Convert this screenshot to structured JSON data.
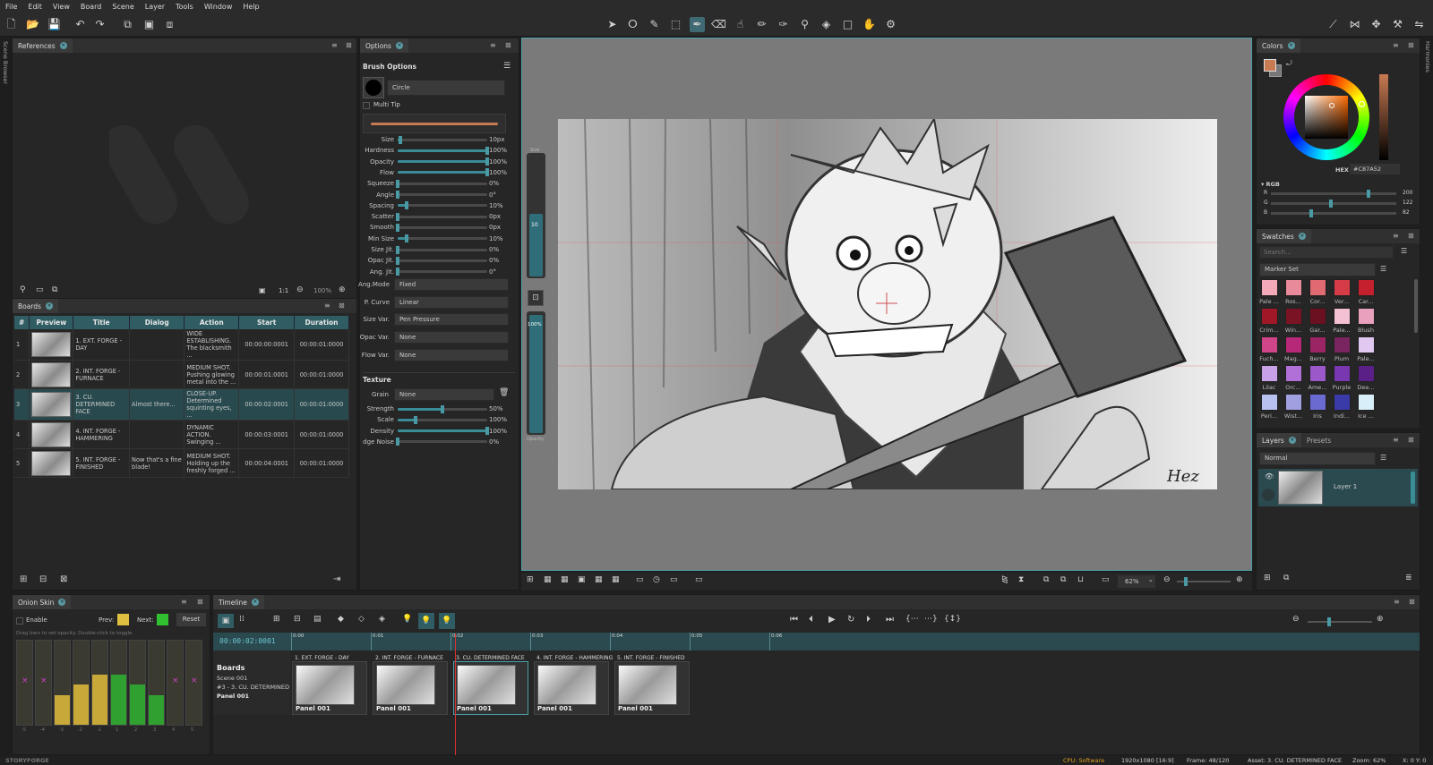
{
  "menu": [
    "File",
    "Edit",
    "View",
    "Board",
    "Scene",
    "Layer",
    "Tools",
    "Window",
    "Help"
  ],
  "references": {
    "tab": "References",
    "zoom_label": "1:1",
    "zoom_pct": "100%"
  },
  "side_left": "Scene Browser",
  "side_right": "Harmonies",
  "boards": {
    "tab": "Boards",
    "columns": [
      "#",
      "Preview",
      "Title",
      "Dialog",
      "Action",
      "Start",
      "Duration"
    ],
    "rows": [
      {
        "num": "1",
        "title": "1. EXT. FORGE - DAY",
        "dialog": "",
        "action": "WIDE ESTABLISHING. The blacksmith ...",
        "start": "00:00:00:0001",
        "duration": "00:00:01:0000"
      },
      {
        "num": "2",
        "title": "2. INT. FORGE - FURNACE",
        "dialog": "",
        "action": "MEDIUM SHOT. Pushing glowing metal into the ...",
        "start": "00:00:01:0001",
        "duration": "00:00:01:0000"
      },
      {
        "num": "3",
        "title": "3. CU. DETERMINED FACE",
        "dialog": "Almost there...",
        "action": "CLOSE-UP. Determined squinting eyes, ...",
        "start": "00:00:02:0001",
        "duration": "00:00:01:0000"
      },
      {
        "num": "4",
        "title": "4. INT. FORGE - HAMMERING",
        "dialog": "",
        "action": "DYNAMIC ACTION. Swinging ...",
        "start": "00:00:03:0001",
        "duration": "00:00:01:0000"
      },
      {
        "num": "5",
        "title": "5. INT. FORGE - FINISHED",
        "dialog": "Now that's a fine blade!",
        "action": "MEDIUM SHOT. Holding up the freshly forged ...",
        "start": "00:00:04:0001",
        "duration": "00:00:01:0000"
      }
    ]
  },
  "options": {
    "tab": "Options",
    "heading": "Brush Options",
    "brush_name": "Circle",
    "multi_tip": "Multi Tip",
    "sliders": [
      {
        "label": "Size",
        "value": "10px",
        "frac": 0.03
      },
      {
        "label": "Hardness",
        "value": "100%",
        "frac": 1.0
      },
      {
        "label": "Opacity",
        "value": "100%",
        "frac": 1.0
      },
      {
        "label": "Flow",
        "value": "100%",
        "frac": 1.0
      },
      {
        "label": "Squeeze",
        "value": "0%",
        "frac": 0.0
      },
      {
        "label": "Angle",
        "value": "0°",
        "frac": 0.0
      },
      {
        "label": "Spacing",
        "value": "10%",
        "frac": 0.1
      },
      {
        "label": "Scatter",
        "value": "0px",
        "frac": 0.0
      },
      {
        "label": "Smooth",
        "value": "0px",
        "frac": 0.0
      },
      {
        "label": "Min Size",
        "value": "10%",
        "frac": 0.1
      },
      {
        "label": "Size Jit.",
        "value": "0%",
        "frac": 0.0
      },
      {
        "label": "Opac Jit.",
        "value": "0%",
        "frac": 0.0
      },
      {
        "label": "Ang. Jit.",
        "value": "0°",
        "frac": 0.0
      }
    ],
    "dropdowns": [
      {
        "label": "Ang.Mode",
        "value": "Fixed"
      },
      {
        "label": "P. Curve",
        "value": "Linear"
      },
      {
        "label": "Size Var.",
        "value": "Pen Pressure"
      },
      {
        "label": "Opac Var.",
        "value": "None"
      },
      {
        "label": "Flow Var.",
        "value": "None"
      }
    ],
    "texture_heading": "Texture",
    "grain_label": "Grain",
    "grain_value": "None",
    "texture_sliders": [
      {
        "label": "Strength",
        "value": "50%",
        "frac": 0.5
      },
      {
        "label": "Scale",
        "value": "100%",
        "frac": 0.2
      },
      {
        "label": "Density",
        "value": "100%",
        "frac": 1.0
      },
      {
        "label": "dge Noise",
        "value": "0%",
        "frac": 0.0
      }
    ]
  },
  "canvas_side": {
    "size_label": "Size",
    "size_value": "10",
    "opacity_value": "100%",
    "opacity_label": "Opacity"
  },
  "canvas_bottom": {
    "zoom": "62%"
  },
  "colors": {
    "tab": "Colors",
    "hex_label": "HEX",
    "hex_value": "#C87A52",
    "rgb_header": "RGB",
    "rgb": [
      {
        "label": "R",
        "value": "200",
        "frac": 0.78
      },
      {
        "label": "G",
        "value": "122",
        "frac": 0.48
      },
      {
        "label": "B",
        "value": "82",
        "frac": 0.32
      }
    ],
    "accent": "#C87A52"
  },
  "swatches": {
    "tab": "Swatches",
    "search_placeholder": "Search...",
    "set": "Marker Set",
    "items": [
      {
        "name": "Pale ...",
        "color": "#f4a9b8"
      },
      {
        "name": "Ros...",
        "color": "#e88a9a"
      },
      {
        "name": "Cor...",
        "color": "#e06a72"
      },
      {
        "name": "Ver...",
        "color": "#d63c48"
      },
      {
        "name": "Car...",
        "color": "#c4202e"
      },
      {
        "name": "Crim...",
        "color": "#a01828"
      },
      {
        "name": "Win...",
        "color": "#7a1424"
      },
      {
        "name": "Gar...",
        "color": "#6a1020"
      },
      {
        "name": "Pale...",
        "color": "#f4c0d4"
      },
      {
        "name": "Blush",
        "color": "#e8a0bc"
      },
      {
        "name": "Fuch...",
        "color": "#d0448a"
      },
      {
        "name": "Mag...",
        "color": "#b82878"
      },
      {
        "name": "Berry",
        "color": "#9a2464"
      },
      {
        "name": "Plum",
        "color": "#7a2460"
      },
      {
        "name": "Pale...",
        "color": "#e0c8f0"
      },
      {
        "name": "Lilac",
        "color": "#c8a0e8"
      },
      {
        "name": "Orc...",
        "color": "#b070d8"
      },
      {
        "name": "Ame...",
        "color": "#9a58c8"
      },
      {
        "name": "Purple",
        "color": "#7a38b0"
      },
      {
        "name": "Dee...",
        "color": "#5a2088"
      },
      {
        "name": "Peri...",
        "color": "#b8c0f0"
      },
      {
        "name": "Wist...",
        "color": "#a0a0e0"
      },
      {
        "name": "Iris",
        "color": "#6a6ad0"
      },
      {
        "name": "Indi...",
        "color": "#3a3aa8"
      },
      {
        "name": "Ice ...",
        "color": "#d8eef8"
      }
    ]
  },
  "layers": {
    "tab": "Layers",
    "tab2": "Presets",
    "blend": "Normal",
    "layer_name": "Layer 1"
  },
  "onion": {
    "tab": "Onion Skin",
    "enable": "Enable",
    "prev": "Prev:",
    "next": "Next:",
    "reset": "Reset",
    "hint": "Drag bars to set opacity. Double-click to toggle.",
    "prev_color": "#e0c040",
    "next_color": "#30c030",
    "bars": [
      {
        "level": 0,
        "color": "#444",
        "x": true,
        "label": "-5"
      },
      {
        "level": 0,
        "color": "#444",
        "x": true,
        "label": "-4"
      },
      {
        "level": 0.35,
        "color": "#c8a838",
        "x": false,
        "label": "-3"
      },
      {
        "level": 0.48,
        "color": "#c8a838",
        "x": false,
        "label": "-2"
      },
      {
        "level": 0.6,
        "color": "#c8a838",
        "x": false,
        "label": "-1"
      },
      {
        "level": 0.6,
        "color": "#30a030",
        "x": false,
        "label": "1"
      },
      {
        "level": 0.48,
        "color": "#30a030",
        "x": false,
        "label": "2"
      },
      {
        "level": 0.35,
        "color": "#30a030",
        "x": false,
        "label": "3"
      },
      {
        "level": 0,
        "color": "#444",
        "x": true,
        "label": "4"
      },
      {
        "level": 0,
        "color": "#444",
        "x": true,
        "label": "5"
      }
    ]
  },
  "timeline": {
    "tab": "Timeline",
    "timecode": "00:00:02:0001",
    "ticks": [
      "0:00",
      "0:01",
      "0:02",
      "0:03",
      "0:04",
      "0:05",
      "0:06"
    ],
    "track_title": "Boards",
    "scene": "Scene 001",
    "board_label": "#3 - 3. CU. DETERMINED",
    "panel_label": "Panel 001",
    "clips": [
      {
        "title": "1. EXT. FORGE - DAY",
        "panel": "Panel 001"
      },
      {
        "title": "2. INT. FORGE - FURNACE",
        "panel": "Panel 001"
      },
      {
        "title": "3. CU. DETERMINED FACE",
        "panel": "Panel 001"
      },
      {
        "title": "4. INT. FORGE - HAMMERING",
        "panel": "Panel 001"
      },
      {
        "title": "5. INT. FORGE - FINISHED",
        "panel": "Panel 001"
      }
    ]
  },
  "status": {
    "app": "STORYFORGE",
    "cpu": "CPU: Software",
    "res": "1920x1080 [16:9]",
    "frame": "Frame: 48/120",
    "asset": "Asset: 3. CU. DETERMINED FACE",
    "zoom": "Zoom: 62%",
    "coords": "X: 0 Y: 0"
  }
}
